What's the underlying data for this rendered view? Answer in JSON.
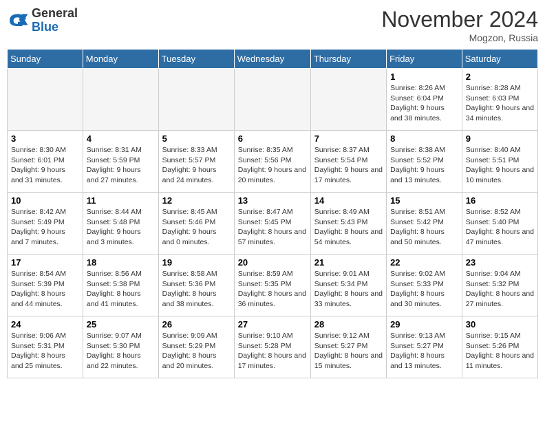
{
  "header": {
    "logo_general": "General",
    "logo_blue": "Blue",
    "month_title": "November 2024",
    "location": "Mogzon, Russia"
  },
  "days_of_week": [
    "Sunday",
    "Monday",
    "Tuesday",
    "Wednesday",
    "Thursday",
    "Friday",
    "Saturday"
  ],
  "weeks": [
    [
      {
        "day": "",
        "info": ""
      },
      {
        "day": "",
        "info": ""
      },
      {
        "day": "",
        "info": ""
      },
      {
        "day": "",
        "info": ""
      },
      {
        "day": "",
        "info": ""
      },
      {
        "day": "1",
        "info": "Sunrise: 8:26 AM\nSunset: 6:04 PM\nDaylight: 9 hours and 38 minutes."
      },
      {
        "day": "2",
        "info": "Sunrise: 8:28 AM\nSunset: 6:03 PM\nDaylight: 9 hours and 34 minutes."
      }
    ],
    [
      {
        "day": "3",
        "info": "Sunrise: 8:30 AM\nSunset: 6:01 PM\nDaylight: 9 hours and 31 minutes."
      },
      {
        "day": "4",
        "info": "Sunrise: 8:31 AM\nSunset: 5:59 PM\nDaylight: 9 hours and 27 minutes."
      },
      {
        "day": "5",
        "info": "Sunrise: 8:33 AM\nSunset: 5:57 PM\nDaylight: 9 hours and 24 minutes."
      },
      {
        "day": "6",
        "info": "Sunrise: 8:35 AM\nSunset: 5:56 PM\nDaylight: 9 hours and 20 minutes."
      },
      {
        "day": "7",
        "info": "Sunrise: 8:37 AM\nSunset: 5:54 PM\nDaylight: 9 hours and 17 minutes."
      },
      {
        "day": "8",
        "info": "Sunrise: 8:38 AM\nSunset: 5:52 PM\nDaylight: 9 hours and 13 minutes."
      },
      {
        "day": "9",
        "info": "Sunrise: 8:40 AM\nSunset: 5:51 PM\nDaylight: 9 hours and 10 minutes."
      }
    ],
    [
      {
        "day": "10",
        "info": "Sunrise: 8:42 AM\nSunset: 5:49 PM\nDaylight: 9 hours and 7 minutes."
      },
      {
        "day": "11",
        "info": "Sunrise: 8:44 AM\nSunset: 5:48 PM\nDaylight: 9 hours and 3 minutes."
      },
      {
        "day": "12",
        "info": "Sunrise: 8:45 AM\nSunset: 5:46 PM\nDaylight: 9 hours and 0 minutes."
      },
      {
        "day": "13",
        "info": "Sunrise: 8:47 AM\nSunset: 5:45 PM\nDaylight: 8 hours and 57 minutes."
      },
      {
        "day": "14",
        "info": "Sunrise: 8:49 AM\nSunset: 5:43 PM\nDaylight: 8 hours and 54 minutes."
      },
      {
        "day": "15",
        "info": "Sunrise: 8:51 AM\nSunset: 5:42 PM\nDaylight: 8 hours and 50 minutes."
      },
      {
        "day": "16",
        "info": "Sunrise: 8:52 AM\nSunset: 5:40 PM\nDaylight: 8 hours and 47 minutes."
      }
    ],
    [
      {
        "day": "17",
        "info": "Sunrise: 8:54 AM\nSunset: 5:39 PM\nDaylight: 8 hours and 44 minutes."
      },
      {
        "day": "18",
        "info": "Sunrise: 8:56 AM\nSunset: 5:38 PM\nDaylight: 8 hours and 41 minutes."
      },
      {
        "day": "19",
        "info": "Sunrise: 8:58 AM\nSunset: 5:36 PM\nDaylight: 8 hours and 38 minutes."
      },
      {
        "day": "20",
        "info": "Sunrise: 8:59 AM\nSunset: 5:35 PM\nDaylight: 8 hours and 36 minutes."
      },
      {
        "day": "21",
        "info": "Sunrise: 9:01 AM\nSunset: 5:34 PM\nDaylight: 8 hours and 33 minutes."
      },
      {
        "day": "22",
        "info": "Sunrise: 9:02 AM\nSunset: 5:33 PM\nDaylight: 8 hours and 30 minutes."
      },
      {
        "day": "23",
        "info": "Sunrise: 9:04 AM\nSunset: 5:32 PM\nDaylight: 8 hours and 27 minutes."
      }
    ],
    [
      {
        "day": "24",
        "info": "Sunrise: 9:06 AM\nSunset: 5:31 PM\nDaylight: 8 hours and 25 minutes."
      },
      {
        "day": "25",
        "info": "Sunrise: 9:07 AM\nSunset: 5:30 PM\nDaylight: 8 hours and 22 minutes."
      },
      {
        "day": "26",
        "info": "Sunrise: 9:09 AM\nSunset: 5:29 PM\nDaylight: 8 hours and 20 minutes."
      },
      {
        "day": "27",
        "info": "Sunrise: 9:10 AM\nSunset: 5:28 PM\nDaylight: 8 hours and 17 minutes."
      },
      {
        "day": "28",
        "info": "Sunrise: 9:12 AM\nSunset: 5:27 PM\nDaylight: 8 hours and 15 minutes."
      },
      {
        "day": "29",
        "info": "Sunrise: 9:13 AM\nSunset: 5:27 PM\nDaylight: 8 hours and 13 minutes."
      },
      {
        "day": "30",
        "info": "Sunrise: 9:15 AM\nSunset: 5:26 PM\nDaylight: 8 hours and 11 minutes."
      }
    ]
  ]
}
